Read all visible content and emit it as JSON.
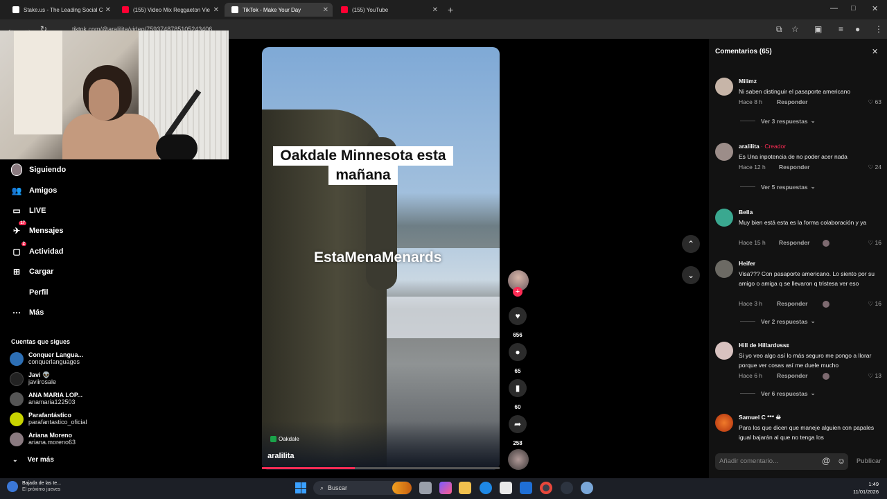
{
  "browser": {
    "tabs": [
      {
        "label": "Stake.us - The Leading Social C",
        "color": "#ffffff",
        "active": false
      },
      {
        "label": "(155) Video Mix Reggaeton Vie",
        "color": "#ff0033",
        "active": false
      },
      {
        "label": "TikTok - Make Your Day",
        "color": "#ffffff",
        "active": true
      },
      {
        "label": "(155) YouTube",
        "color": "#ff0033",
        "active": false
      }
    ],
    "url": "tiktok.com/@aralilita/video/7593748785105243406",
    "newtab": "+",
    "win_min": "—",
    "win_max": "□",
    "win_close": "✕"
  },
  "sidebar": {
    "items": [
      {
        "label": "Siguiendo",
        "icon": "following-icon"
      },
      {
        "label": "Amigos",
        "icon": "friends-icon",
        "glyph": "👥"
      },
      {
        "label": "LIVE",
        "icon": "live-icon",
        "glyph": "▭"
      },
      {
        "label": "Mensajes",
        "icon": "messages-icon",
        "glyph": "✈",
        "badge": "17"
      },
      {
        "label": "Actividad",
        "icon": "activity-icon",
        "glyph": "▢",
        "badge": "2"
      },
      {
        "label": "Cargar",
        "icon": "upload-icon",
        "glyph": "⊞"
      },
      {
        "label": "Perfil",
        "icon": "profile-icon",
        "glyph": ""
      },
      {
        "label": "Más",
        "icon": "more-icon",
        "glyph": "⋯"
      }
    ],
    "following_title": "Cuentas que sigues",
    "following": [
      {
        "name": "Conquer Langua...",
        "user": "conquerlanguages",
        "color": "#2d6fb5"
      },
      {
        "name": "Javi 👽",
        "user": "javiirosale",
        "color": "#222222"
      },
      {
        "name": "ANA MARIA LOP...",
        "user": "anamaria122503",
        "color": "#555555"
      },
      {
        "name": "Parafantástico",
        "user": "parafantastico_oficial",
        "color": "#c8d400"
      },
      {
        "name": "Ariana Moreno",
        "user": "ariana.moreno63",
        "color": "#8a7a80"
      }
    ],
    "see_more": "Ver más"
  },
  "video": {
    "caption_lines": [
      "Oakdale  Minnesota esta",
      "mañana"
    ],
    "overlay_text": "EstaMenaMenards",
    "location": "Oakdale",
    "author": "aralilita",
    "progress_fraction": 0.39
  },
  "actions": {
    "likes": "656",
    "comments": "65",
    "saves": "60",
    "shares": "258"
  },
  "comments_panel": {
    "title": "Comentarios (65)",
    "reply_label": "Responder",
    "items": [
      {
        "user": "Milimz",
        "creator_tag": "",
        "text": "Ni saben distinguir el pasaporte americano",
        "time": "Hace 8 h",
        "likes": "63",
        "more": "Ver 3 respuestas",
        "avatar": "#c7b5a8",
        "liked_by_creator": false
      },
      {
        "user": "aralilita",
        "creator_tag": " · Creador",
        "text": "Es Una inpotencia de no poder acer nada",
        "time": "Hace 12 h",
        "likes": "24",
        "more": "Ver 5 respuestas",
        "avatar": "#9c8d89",
        "liked_by_creator": false
      },
      {
        "user": "Bella",
        "creator_tag": "",
        "text": "Muy bien está esta es la forma colaboración y ya",
        "time": "Hace 15 h",
        "likes": "16",
        "more": "",
        "avatar": "#3aa890",
        "liked_by_creator": true
      },
      {
        "user": "Heifer",
        "creator_tag": "",
        "text": "Visa??? Con pasaporte americano. Lo siento por su amigo o amiga q se llevaron q tristesa ver eso",
        "time": "Hace 3 h",
        "likes": "16",
        "more": "Ver 2 respuestas",
        "avatar": "#6c6a64",
        "liked_by_creator": true
      },
      {
        "user": "Hill de Hillardᴜsɴɪ",
        "creator_tag": "",
        "text": "Si yo veo algo así lo más seguro me pongo a llorar porque ver cosas así me duele mucho",
        "time": "Hace 6 h",
        "likes": "13",
        "more": "Ver 6 respuestas",
        "avatar": "#d8c2c0",
        "liked_by_creator": true
      },
      {
        "user": "Samuel C *** ☠",
        "creator_tag": "",
        "text": "Para los que dicen que maneje alguien con papales igual bajarán al que no tenga los",
        "time": "",
        "likes": "",
        "more": "",
        "avatar": "#d84a1a",
        "liked_by_creator": false
      }
    ],
    "input_placeholder": "Añadir comentario...",
    "publish": "Publicar"
  },
  "taskbar": {
    "notification_title": "Bajada de las te...",
    "notification_sub": "El próximo jueves",
    "search": "Buscar",
    "time": "1:49",
    "date": "11/01/2026"
  }
}
